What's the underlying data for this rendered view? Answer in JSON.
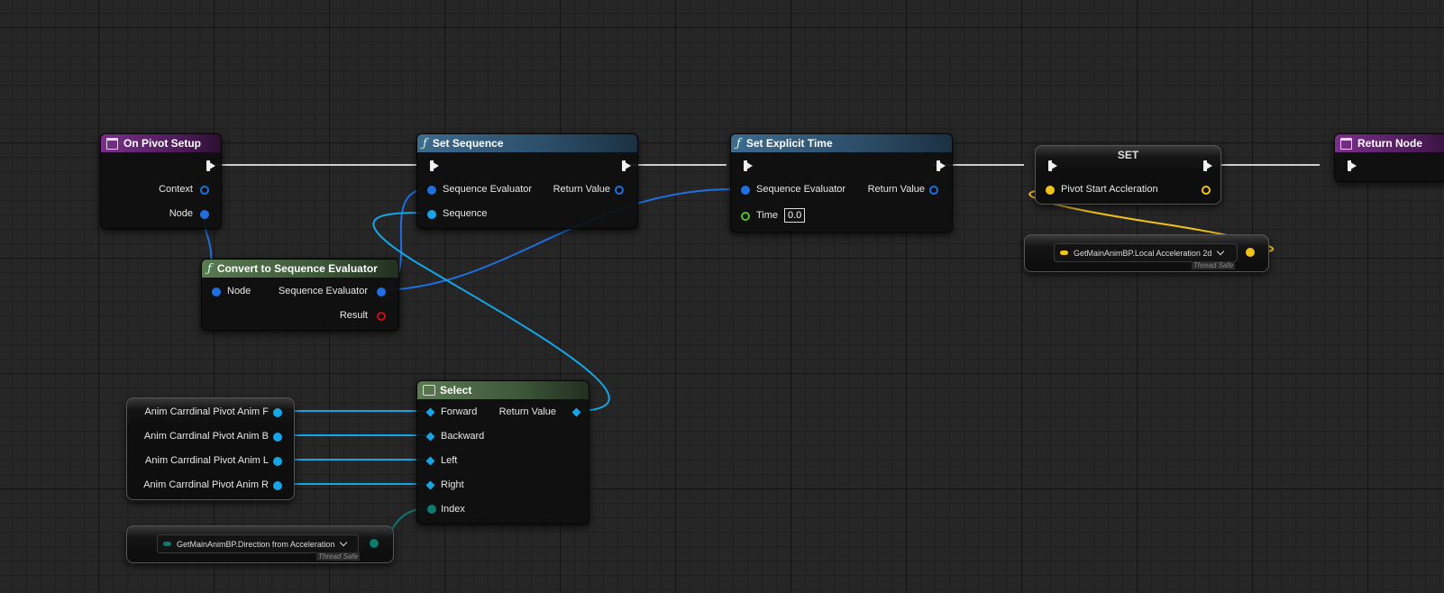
{
  "nodes": {
    "on_pivot_setup": {
      "title": "On Pivot Setup",
      "context": "Context",
      "node": "Node"
    },
    "set_sequence": {
      "title": "Set Sequence",
      "sequence_evaluator": "Sequence Evaluator",
      "return_value": "Return Value",
      "sequence": "Sequence"
    },
    "set_explicit_time": {
      "title": "Set Explicit Time",
      "sequence_evaluator": "Sequence Evaluator",
      "return_value": "Return Value",
      "time": "Time",
      "time_value": "0.0"
    },
    "set_var": {
      "title": "SET",
      "pin": "Pivot Start Accleration"
    },
    "return_node": {
      "title": "Return Node"
    },
    "get_local_accel": {
      "label": "GetMainAnimBP.Local Acceleration 2d",
      "thread_safe": "Thread Safe"
    },
    "convert": {
      "title": "Convert to Sequence Evaluator",
      "node": "Node",
      "sequence_evaluator": "Sequence Evaluator",
      "result": "Result"
    },
    "select": {
      "title": "Select",
      "forward": "Forward",
      "backward": "Backward",
      "left": "Left",
      "right": "Right",
      "index": "Index",
      "return_value": "Return Value"
    },
    "anim_vars": [
      "Anim Carrdinal Pivot Anim F",
      "Anim Carrdinal Pivot Anim B",
      "Anim Carrdinal Pivot Anim L",
      "Anim Carrdinal Pivot Anim R"
    ],
    "get_direction": {
      "label": "GetMainAnimBP.Direction from Acceleration",
      "thread_safe": "Thread Safe"
    }
  },
  "colors": {
    "exec": "#f0f0f0",
    "struct": "#1f6fe0",
    "object": "#16a6e8",
    "vector2d": "#f2c21a",
    "enum": "#0c7a6e",
    "float": "#4fc228",
    "event": "#7a2f8a"
  }
}
